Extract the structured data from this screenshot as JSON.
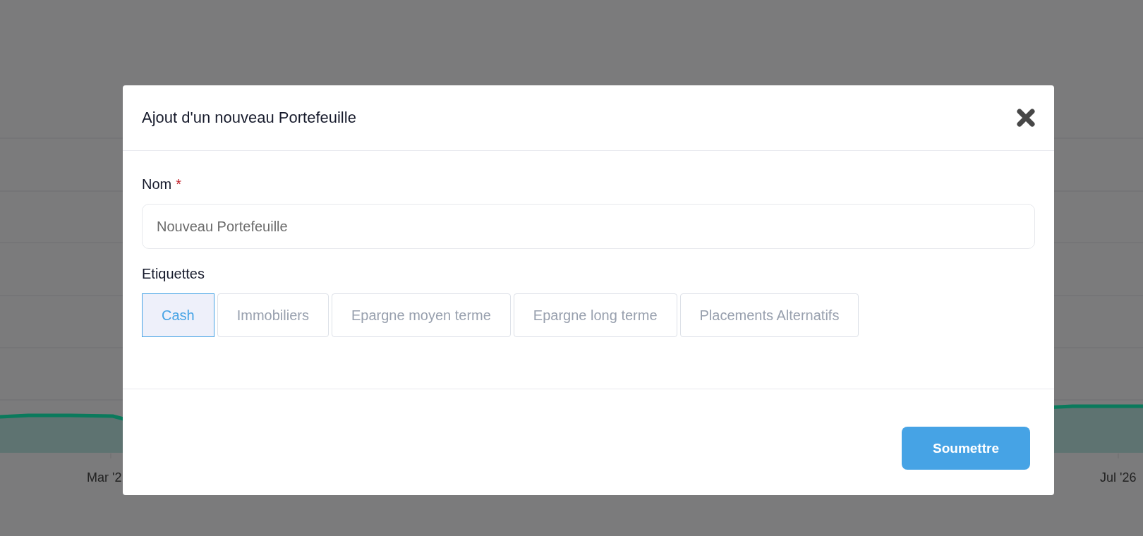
{
  "background_chart": {
    "x_labels": [
      "Mar '2",
      "Jul '26"
    ]
  },
  "modal": {
    "title": "Ajout d'un nouveau Portefeuille",
    "name_field": {
      "label": "Nom",
      "required_mark": "*",
      "value": "Nouveau Portefeuille"
    },
    "tags_field": {
      "label": "Etiquettes",
      "options": [
        {
          "label": "Cash",
          "selected": true
        },
        {
          "label": "Immobiliers",
          "selected": false
        },
        {
          "label": "Epargne moyen terme",
          "selected": false
        },
        {
          "label": "Epargne long terme",
          "selected": false
        },
        {
          "label": "Placements Alternatifs",
          "selected": false
        }
      ]
    },
    "submit_button": "Soumettre"
  }
}
